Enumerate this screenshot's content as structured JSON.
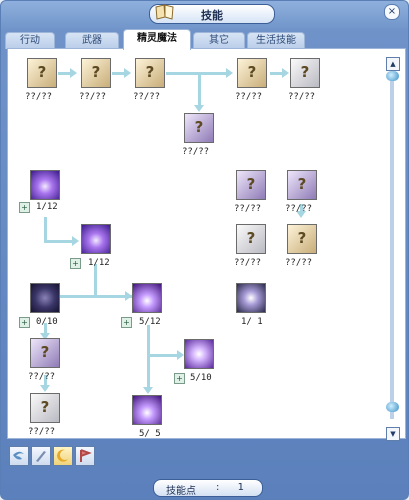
{
  "window": {
    "title": "技能",
    "close_label": "×"
  },
  "tabs": [
    {
      "label": "行动",
      "active": false
    },
    {
      "label": "武器",
      "active": false
    },
    {
      "label": "精灵魔法",
      "active": true
    },
    {
      "label": "其它",
      "active": false
    },
    {
      "label": "生活技能",
      "active": false
    }
  ],
  "skills": [
    {
      "name": "skill-1",
      "level": "??/??",
      "locked": true
    },
    {
      "name": "skill-2",
      "level": "??/??",
      "locked": true
    },
    {
      "name": "skill-3",
      "level": "??/??",
      "locked": true
    },
    {
      "name": "skill-4",
      "level": "??/??",
      "locked": true
    },
    {
      "name": "skill-5",
      "level": "??/??",
      "locked": true
    },
    {
      "name": "skill-6",
      "level": "??/??",
      "locked": true
    },
    {
      "name": "skill-7",
      "level": "1/12",
      "locked": false
    },
    {
      "name": "skill-8",
      "level": "1/12",
      "locked": false
    },
    {
      "name": "skill-9",
      "level": "0/10",
      "locked": false
    },
    {
      "name": "skill-10",
      "level": "5/12",
      "locked": false
    },
    {
      "name": "skill-11",
      "level": "5/10",
      "locked": false
    },
    {
      "name": "skill-12",
      "level": "5/ 5",
      "locked": false
    },
    {
      "name": "skill-13",
      "level": "??/??",
      "locked": true
    },
    {
      "name": "skill-14",
      "level": "??/??",
      "locked": true
    },
    {
      "name": "skill-15",
      "level": "??/??",
      "locked": true
    },
    {
      "name": "skill-16",
      "level": "??/??",
      "locked": true
    },
    {
      "name": "skill-17",
      "level": "??/??",
      "locked": true
    },
    {
      "name": "skill-18",
      "level": "??/??",
      "locked": true
    },
    {
      "name": "skill-19",
      "level": "1/ 1",
      "locked": false
    }
  ],
  "question_mark": "?",
  "plus_glyph": "+",
  "footer": {
    "label": "技能点",
    "separator": ":",
    "value": "1"
  },
  "icons": [
    "wind-icon",
    "sword-icon",
    "moon-icon",
    "flag-icon"
  ],
  "colors": {
    "frame": "#6f93c9",
    "connector": "#a6d6e2",
    "panel": "#ffffff"
  }
}
